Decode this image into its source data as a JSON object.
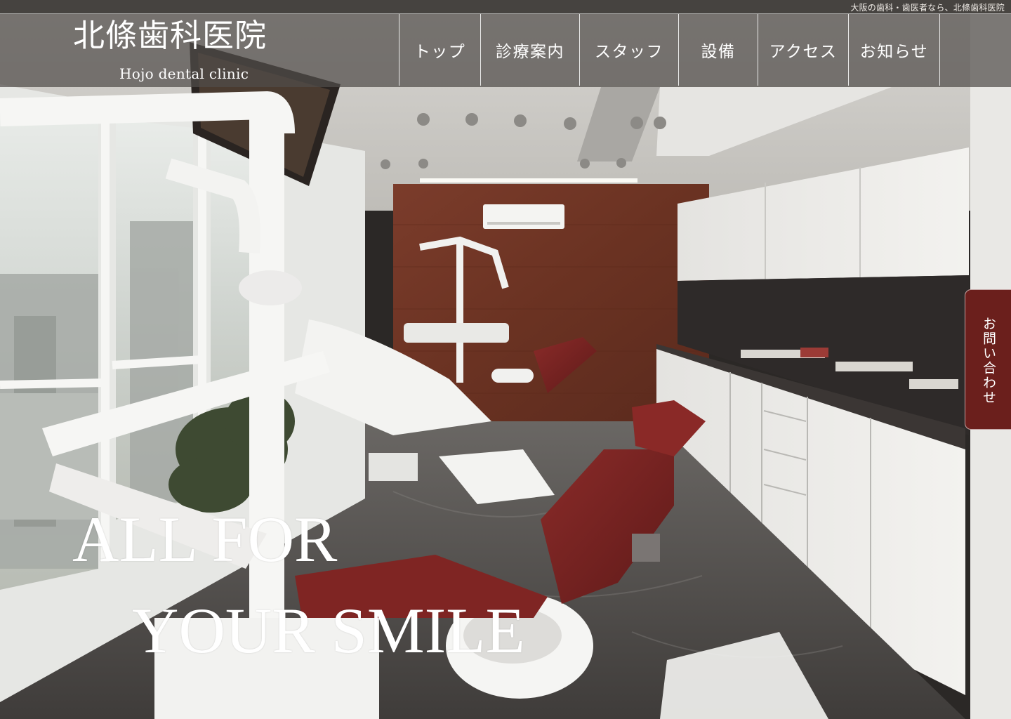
{
  "site": {
    "tagline": "大阪の歯科・歯医者なら、北條歯科医院",
    "logo_title": "北條歯科医院",
    "logo_subtitle": "Hojo dental clinic"
  },
  "nav": {
    "items": [
      {
        "label": "トップ"
      },
      {
        "label": "診療案内"
      },
      {
        "label": "スタッフ"
      },
      {
        "label": "設備"
      },
      {
        "label": "アクセス"
      },
      {
        "label": "お知らせ"
      }
    ]
  },
  "hero": {
    "line1": "ALL FOR",
    "line2": "YOUR SMILE"
  },
  "contact_tab": {
    "label": "お問い合わせ"
  },
  "colors": {
    "contact_tab_bg": "#6b1f1c",
    "header_band": "#504c49",
    "text": "#ffffff"
  }
}
